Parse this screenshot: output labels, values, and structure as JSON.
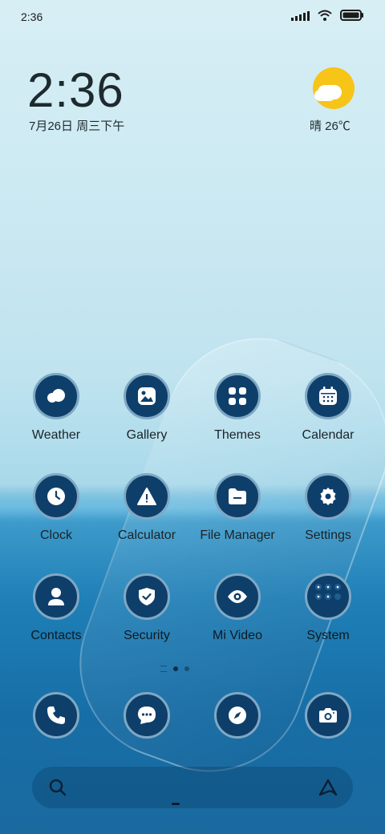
{
  "status_bar": {
    "time": "2:36"
  },
  "clock": {
    "time": "2:36",
    "date": "7月26日 周三下午"
  },
  "weather": {
    "text": "晴 26℃"
  },
  "apps": [
    {
      "label": "Weather",
      "icon": "weather-icon"
    },
    {
      "label": "Gallery",
      "icon": "gallery-icon"
    },
    {
      "label": "Themes",
      "icon": "themes-icon"
    },
    {
      "label": "Calendar",
      "icon": "calendar-icon"
    },
    {
      "label": "Clock",
      "icon": "clock-icon"
    },
    {
      "label": "Calculator",
      "icon": "calculator-icon"
    },
    {
      "label": "File Manager",
      "icon": "file-manager-icon"
    },
    {
      "label": "Settings",
      "icon": "settings-icon"
    },
    {
      "label": "Contacts",
      "icon": "contacts-icon"
    },
    {
      "label": "Security",
      "icon": "security-icon"
    },
    {
      "label": "Mi Video",
      "icon": "mi-video-icon"
    },
    {
      "label": "System",
      "icon": "system-folder-icon"
    }
  ],
  "dock": [
    {
      "icon": "phone-icon"
    },
    {
      "icon": "messages-icon"
    },
    {
      "icon": "browser-icon"
    },
    {
      "icon": "camera-icon"
    }
  ],
  "colors": {
    "icon_bg": "#0e3f6a",
    "icon_border": "#7fa8c4",
    "sun": "#f7c418"
  }
}
